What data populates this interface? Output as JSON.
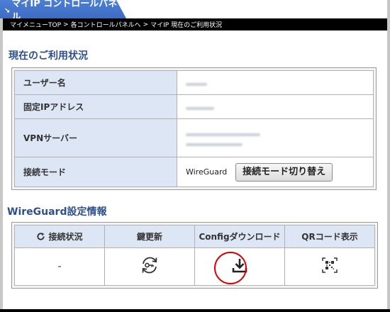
{
  "header": {
    "tab_title": "マイIP コントロールパネル",
    "tab_mark": "↘"
  },
  "breadcrumb": {
    "items": [
      "マイメニューTOP",
      ">",
      "各コントロールパネルへ",
      ">",
      "マイIP 現在のご利用状況"
    ]
  },
  "status_section": {
    "title": "現在のご利用状況",
    "rows": [
      {
        "label": "ユーザー名",
        "value": ""
      },
      {
        "label": "固定IPアドレス",
        "value": ""
      },
      {
        "label": "VPNサーバー",
        "value": ""
      },
      {
        "label": "接続モード",
        "value": "WireGuard"
      }
    ],
    "switch_button": "接続モード切り替え"
  },
  "wireguard_section": {
    "title": "WireGuard設定情報",
    "headers": [
      "接続状況",
      "鍵更新",
      "Configダウンロード",
      "QRコード表示"
    ],
    "status_value": "-"
  },
  "colors": {
    "accent": "#2d4f8e",
    "tab_blue": "#4d7fd6",
    "label_bg": "#dde6f5",
    "highlight": "#d60000"
  }
}
